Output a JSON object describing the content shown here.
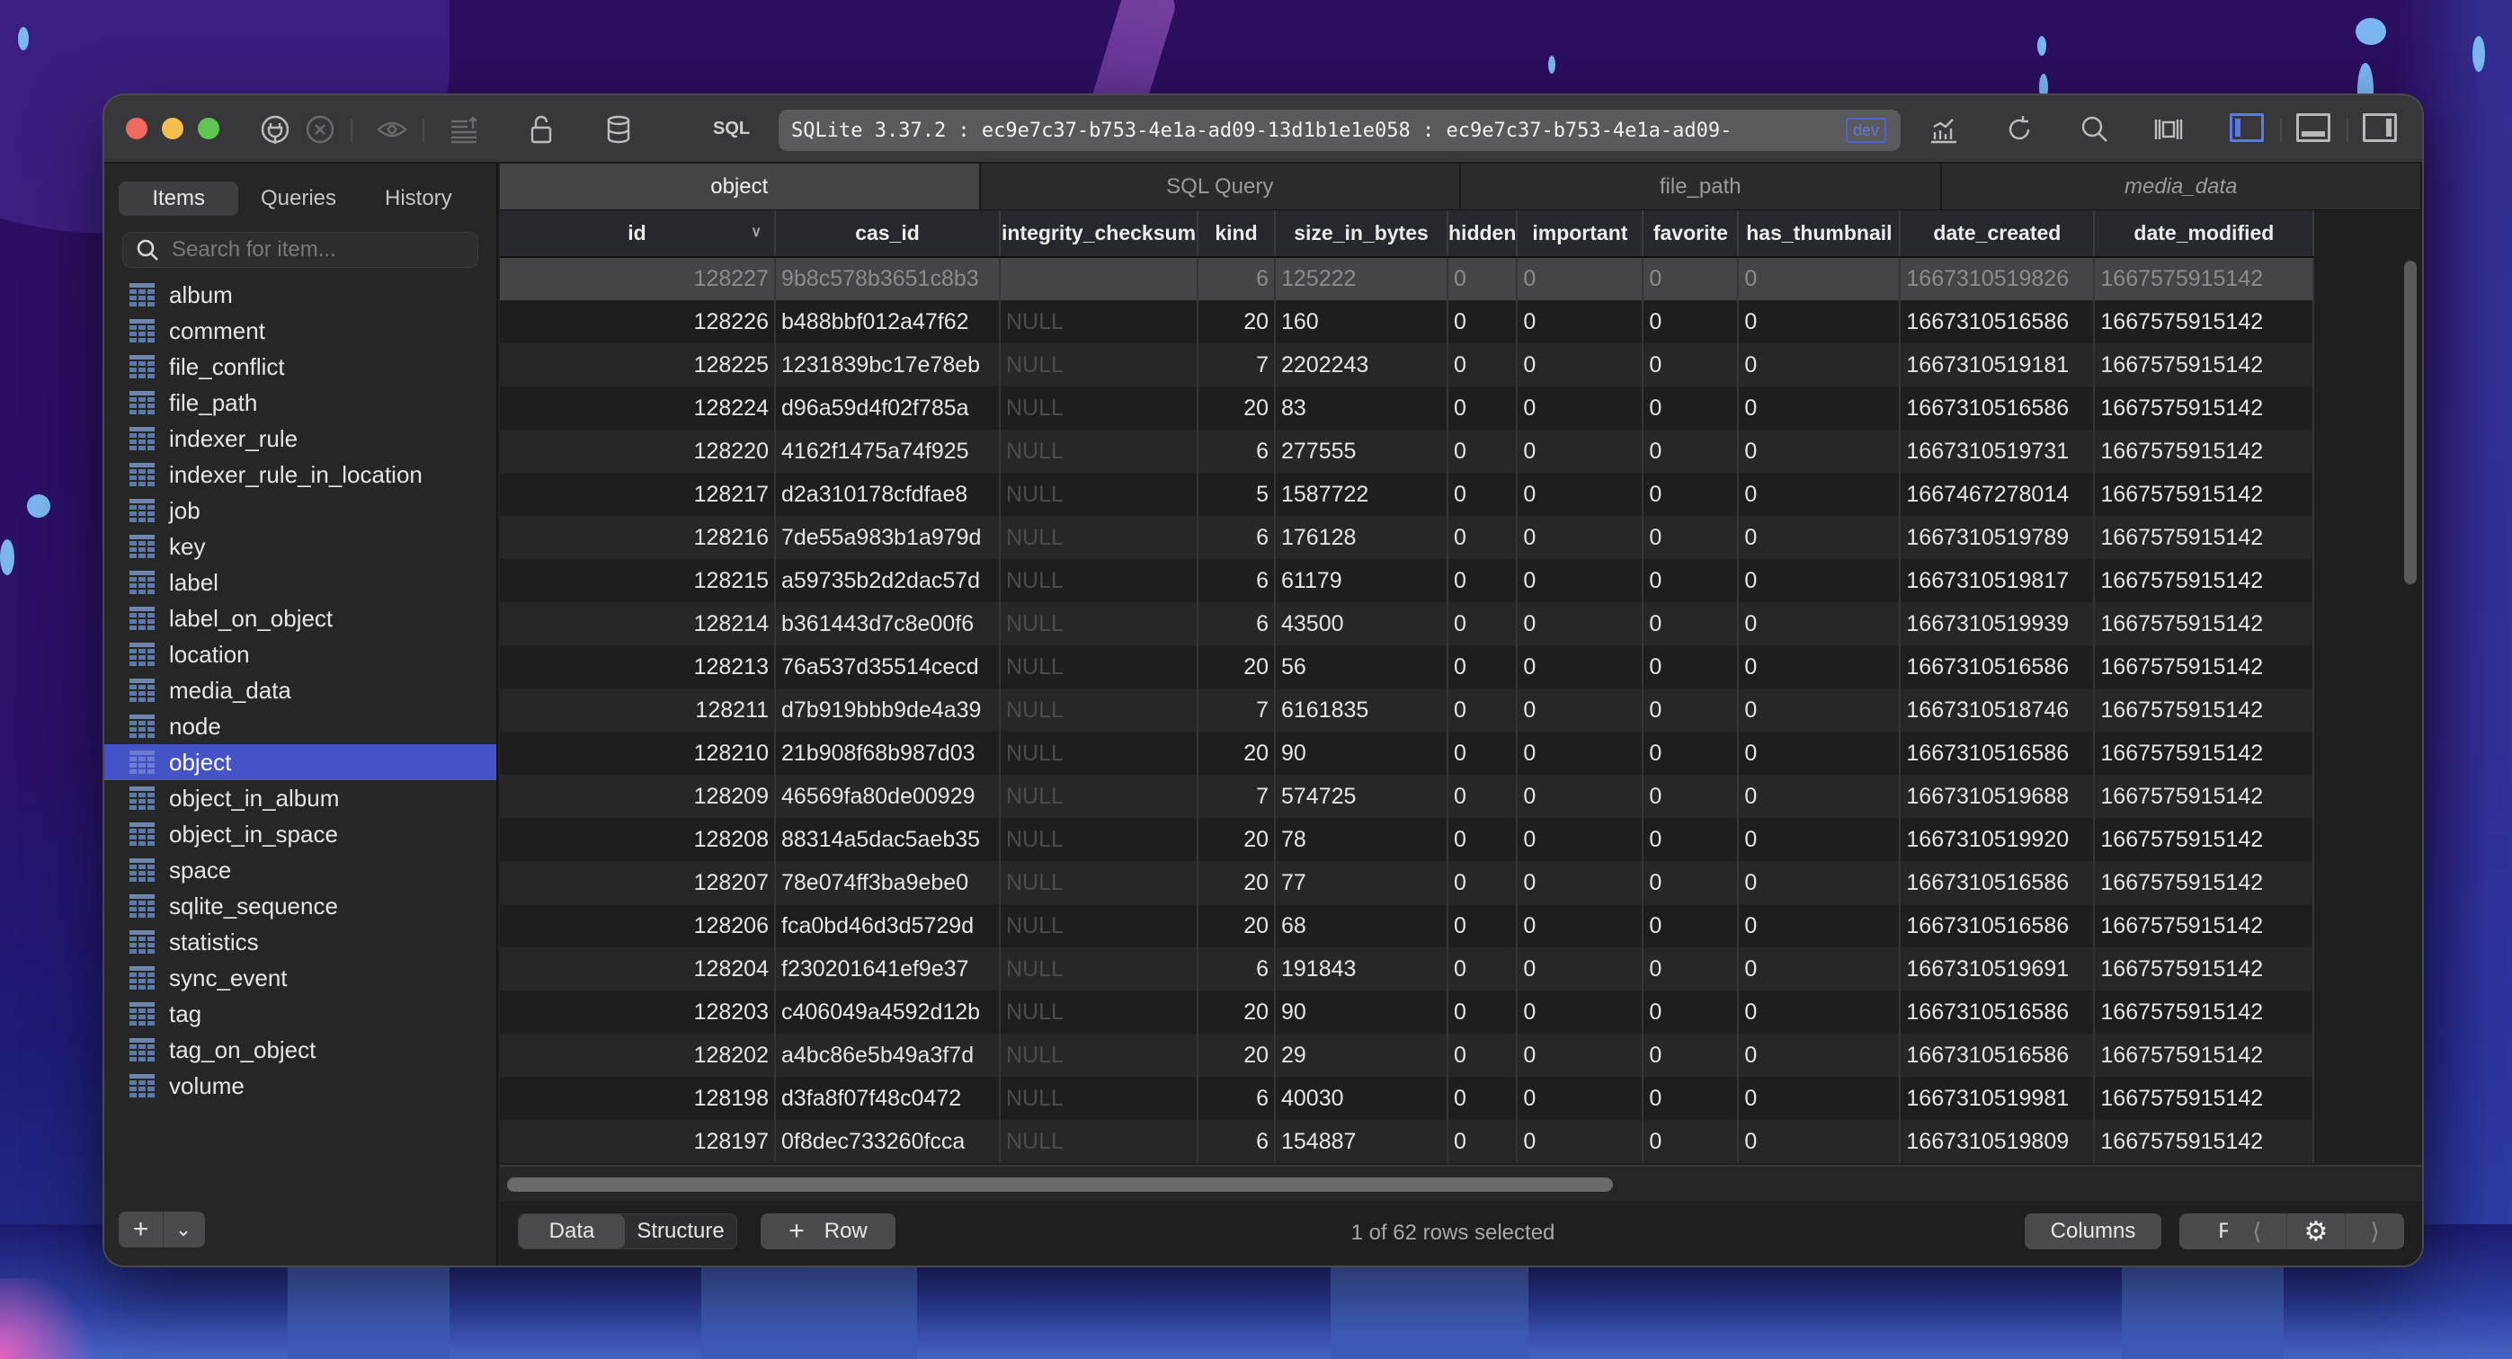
{
  "toolbar": {
    "sql_label": "SQL",
    "connection": "SQLite 3.37.2 : ec9e7c37-b753-4e1a-ad09-13d1b1e1e058 : ec9e7c37-b753-4e1a-ad09-",
    "env_badge": "dev",
    "accent": "#5a78e6"
  },
  "sidebar": {
    "segments": [
      {
        "label": "Items",
        "active": true
      },
      {
        "label": "Queries",
        "active": false
      },
      {
        "label": "History",
        "active": false
      }
    ],
    "search_placeholder": "Search for item...",
    "selected": "object",
    "items": [
      "album",
      "comment",
      "file_conflict",
      "file_path",
      "indexer_rule",
      "indexer_rule_in_location",
      "job",
      "key",
      "label",
      "label_on_object",
      "location",
      "media_data",
      "node",
      "object",
      "object_in_album",
      "object_in_space",
      "space",
      "sqlite_sequence",
      "statistics",
      "sync_event",
      "tag",
      "tag_on_object",
      "volume"
    ],
    "selected_color": "#4553c8"
  },
  "tabs": [
    {
      "label": "object",
      "active": true,
      "italic": false
    },
    {
      "label": "SQL Query",
      "active": false,
      "italic": false
    },
    {
      "label": "file_path",
      "active": false,
      "italic": false
    },
    {
      "label": "media_data",
      "active": false,
      "italic": true
    }
  ],
  "grid": {
    "columns": [
      "id",
      "cas_id",
      "integrity_checksum",
      "kind",
      "size_in_bytes",
      "hidden",
      "important",
      "favorite",
      "has_thumbnail",
      "date_created",
      "date_modified"
    ],
    "sorted_column": "id",
    "selected_row": 0,
    "rows": [
      [
        "128227",
        "9b8c578b3651c8b3",
        "",
        "6",
        "125222",
        "0",
        "0",
        "0",
        "0",
        "1667310519826",
        "1667575915142"
      ],
      [
        "128226",
        "b488bbf012a47f62",
        "NULL",
        "20",
        "160",
        "0",
        "0",
        "0",
        "0",
        "1667310516586",
        "1667575915142"
      ],
      [
        "128225",
        "1231839bc17e78eb",
        "NULL",
        "7",
        "2202243",
        "0",
        "0",
        "0",
        "0",
        "1667310519181",
        "1667575915142"
      ],
      [
        "128224",
        "d96a59d4f02f785a",
        "NULL",
        "20",
        "83",
        "0",
        "0",
        "0",
        "0",
        "1667310516586",
        "1667575915142"
      ],
      [
        "128220",
        "4162f1475a74f925",
        "NULL",
        "6",
        "277555",
        "0",
        "0",
        "0",
        "0",
        "1667310519731",
        "1667575915142"
      ],
      [
        "128217",
        "d2a310178cfdfae8",
        "NULL",
        "5",
        "1587722",
        "0",
        "0",
        "0",
        "0",
        "1667467278014",
        "1667575915142"
      ],
      [
        "128216",
        "7de55a983b1a979d",
        "NULL",
        "6",
        "176128",
        "0",
        "0",
        "0",
        "0",
        "1667310519789",
        "1667575915142"
      ],
      [
        "128215",
        "a59735b2d2dac57d",
        "NULL",
        "6",
        "61179",
        "0",
        "0",
        "0",
        "0",
        "1667310519817",
        "1667575915142"
      ],
      [
        "128214",
        "b361443d7c8e00f6",
        "NULL",
        "6",
        "43500",
        "0",
        "0",
        "0",
        "0",
        "1667310519939",
        "1667575915142"
      ],
      [
        "128213",
        "76a537d35514cecd",
        "NULL",
        "20",
        "56",
        "0",
        "0",
        "0",
        "0",
        "1667310516586",
        "1667575915142"
      ],
      [
        "128211",
        "d7b919bbb9de4a39",
        "NULL",
        "7",
        "6161835",
        "0",
        "0",
        "0",
        "0",
        "1667310518746",
        "1667575915142"
      ],
      [
        "128210",
        "21b908f68b987d03",
        "NULL",
        "20",
        "90",
        "0",
        "0",
        "0",
        "0",
        "1667310516586",
        "1667575915142"
      ],
      [
        "128209",
        "46569fa80de00929",
        "NULL",
        "7",
        "574725",
        "0",
        "0",
        "0",
        "0",
        "1667310519688",
        "1667575915142"
      ],
      [
        "128208",
        "88314a5dac5aeb35",
        "NULL",
        "20",
        "78",
        "0",
        "0",
        "0",
        "0",
        "1667310519920",
        "1667575915142"
      ],
      [
        "128207",
        "78e074ff3ba9ebe0",
        "NULL",
        "20",
        "77",
        "0",
        "0",
        "0",
        "0",
        "1667310516586",
        "1667575915142"
      ],
      [
        "128206",
        "fca0bd46d3d5729d",
        "NULL",
        "20",
        "68",
        "0",
        "0",
        "0",
        "0",
        "1667310516586",
        "1667575915142"
      ],
      [
        "128204",
        "f230201641ef9e37",
        "NULL",
        "6",
        "191843",
        "0",
        "0",
        "0",
        "0",
        "1667310519691",
        "1667575915142"
      ],
      [
        "128203",
        "c406049a4592d12b",
        "NULL",
        "20",
        "90",
        "0",
        "0",
        "0",
        "0",
        "1667310516586",
        "1667575915142"
      ],
      [
        "128202",
        "a4bc86e5b49a3f7d",
        "NULL",
        "20",
        "29",
        "0",
        "0",
        "0",
        "0",
        "1667310516586",
        "1667575915142"
      ],
      [
        "128198",
        "d3fa8f07f48c0472",
        "NULL",
        "6",
        "40030",
        "0",
        "0",
        "0",
        "0",
        "1667310519981",
        "1667575915142"
      ],
      [
        "128197",
        "0f8dec733260fcca",
        "NULL",
        "6",
        "154887",
        "0",
        "0",
        "0",
        "0",
        "1667310519809",
        "1667575915142"
      ]
    ]
  },
  "footer": {
    "data_label": "Data",
    "structure_label": "Structure",
    "add_row_label": "Row",
    "status": "1 of 62 rows selected",
    "columns_label": "Columns",
    "filters_label": "Filters"
  }
}
